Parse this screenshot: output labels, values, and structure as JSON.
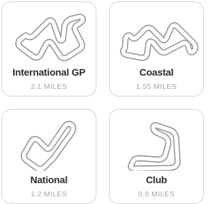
{
  "tracks": [
    {
      "name": "International GP",
      "distance": "2.1 MILES",
      "icon": "international-gp-track-icon"
    },
    {
      "name": "Coastal",
      "distance": "1.55 MILES",
      "icon": "coastal-track-icon"
    },
    {
      "name": "National",
      "distance": "1.2 MILES",
      "icon": "national-track-icon"
    },
    {
      "name": "Club",
      "distance": "0.8 MILES",
      "icon": "club-track-icon"
    }
  ],
  "colors": {
    "border": "#d2d2d2",
    "track_outline": "#9a9a9a",
    "title": "#2b2b2b",
    "subtitle": "#a3a3a3"
  }
}
